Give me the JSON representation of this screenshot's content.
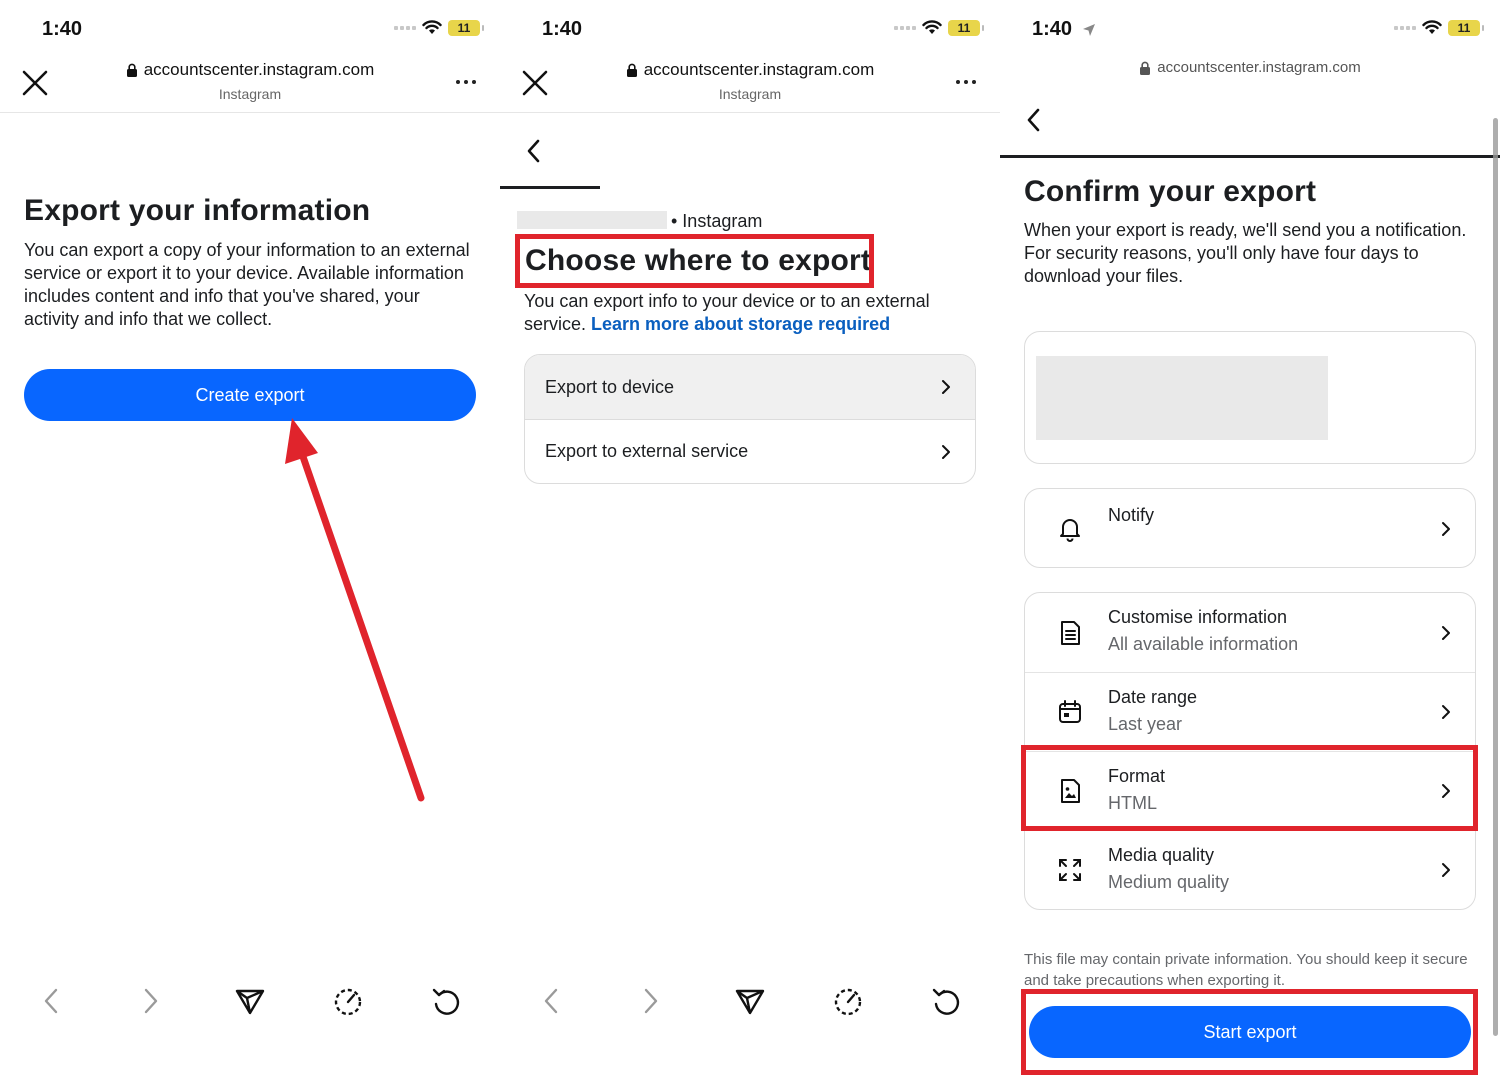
{
  "status_bar": {
    "time": "1:40",
    "battery": "11",
    "icons": [
      "signal-icon",
      "wifi-icon",
      "battery-icon",
      "location-arrow-icon"
    ]
  },
  "browser": {
    "url": "accountscenter.instagram.com",
    "site_name": "Instagram",
    "icons": [
      "close-icon",
      "lock-icon",
      "more-icon",
      "back-icon",
      "forward-icon",
      "send-icon",
      "speed-icon",
      "reload-icon"
    ]
  },
  "panel1": {
    "title": "Export your information",
    "description": "You can export a copy of your information to an external service or export it to your device. Available information includes content and info that you've shared, your activity and info that we collect.",
    "button_label": "Create export"
  },
  "panel2": {
    "account_suffix": "• Instagram",
    "title": "Choose where to export",
    "description": "You can export info to your device or to an external service.",
    "link_text": "Learn more about storage required",
    "options": [
      {
        "label": "Export to device"
      },
      {
        "label": "Export to external service"
      }
    ]
  },
  "panel3": {
    "title": "Confirm your export",
    "description": "When your export is ready, we'll send you a notification. For security reasons, you'll only have four days to download your files.",
    "notify_label": "Notify",
    "settings": [
      {
        "title": "Customise information",
        "value": "All available information",
        "icon": "document-list-icon"
      },
      {
        "title": "Date range",
        "value": "Last year",
        "icon": "calendar-icon"
      },
      {
        "title": "Format",
        "value": "HTML",
        "icon": "image-file-icon"
      },
      {
        "title": "Media quality",
        "value": "Medium quality",
        "icon": "expand-icon"
      }
    ],
    "disclaimer": "This file may contain private information. You should keep it secure and take precautions when exporting it.",
    "button_label": "Start export"
  },
  "colors": {
    "primary_button": "#0866ff",
    "link": "#0a5fbf",
    "annotation": "#e0242c"
  }
}
